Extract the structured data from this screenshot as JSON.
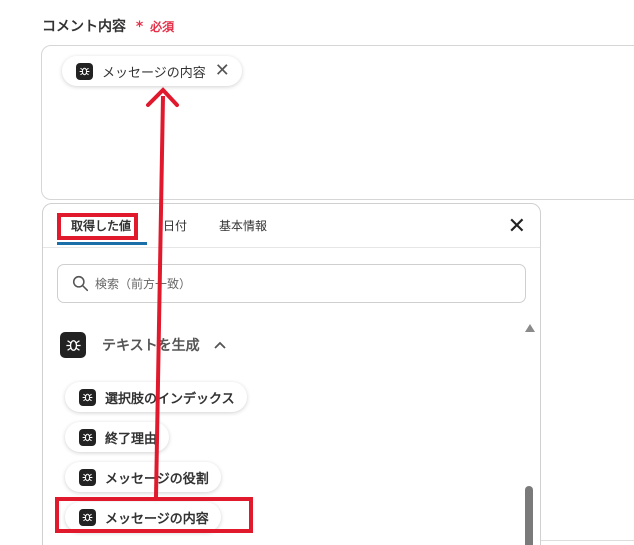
{
  "field": {
    "label": "コメント内容",
    "required_star": "*",
    "required_text": "必須"
  },
  "selected_chip": {
    "icon": "app-logo-icon",
    "label": "メッセージの内容",
    "remove_icon": "close-icon"
  },
  "panel": {
    "tabs": [
      {
        "label": "取得した値",
        "active": true
      },
      {
        "label": "日付",
        "active": false
      },
      {
        "label": "基本情報",
        "active": false
      }
    ],
    "close_icon": "close-icon",
    "search": {
      "placeholder": "検索（前方一致）",
      "icon": "search-icon"
    },
    "group": {
      "label": "テキストを生成",
      "expanded": true,
      "icon": "app-logo-icon"
    },
    "items": [
      {
        "label": "選択肢のインデックス"
      },
      {
        "label": "終了理由"
      },
      {
        "label": "メッセージの役割"
      },
      {
        "label": "メッセージの内容"
      }
    ]
  },
  "colors": {
    "highlight": "#e0192d",
    "tab_underline": "#1a6fa8",
    "required": "#e5324a"
  }
}
